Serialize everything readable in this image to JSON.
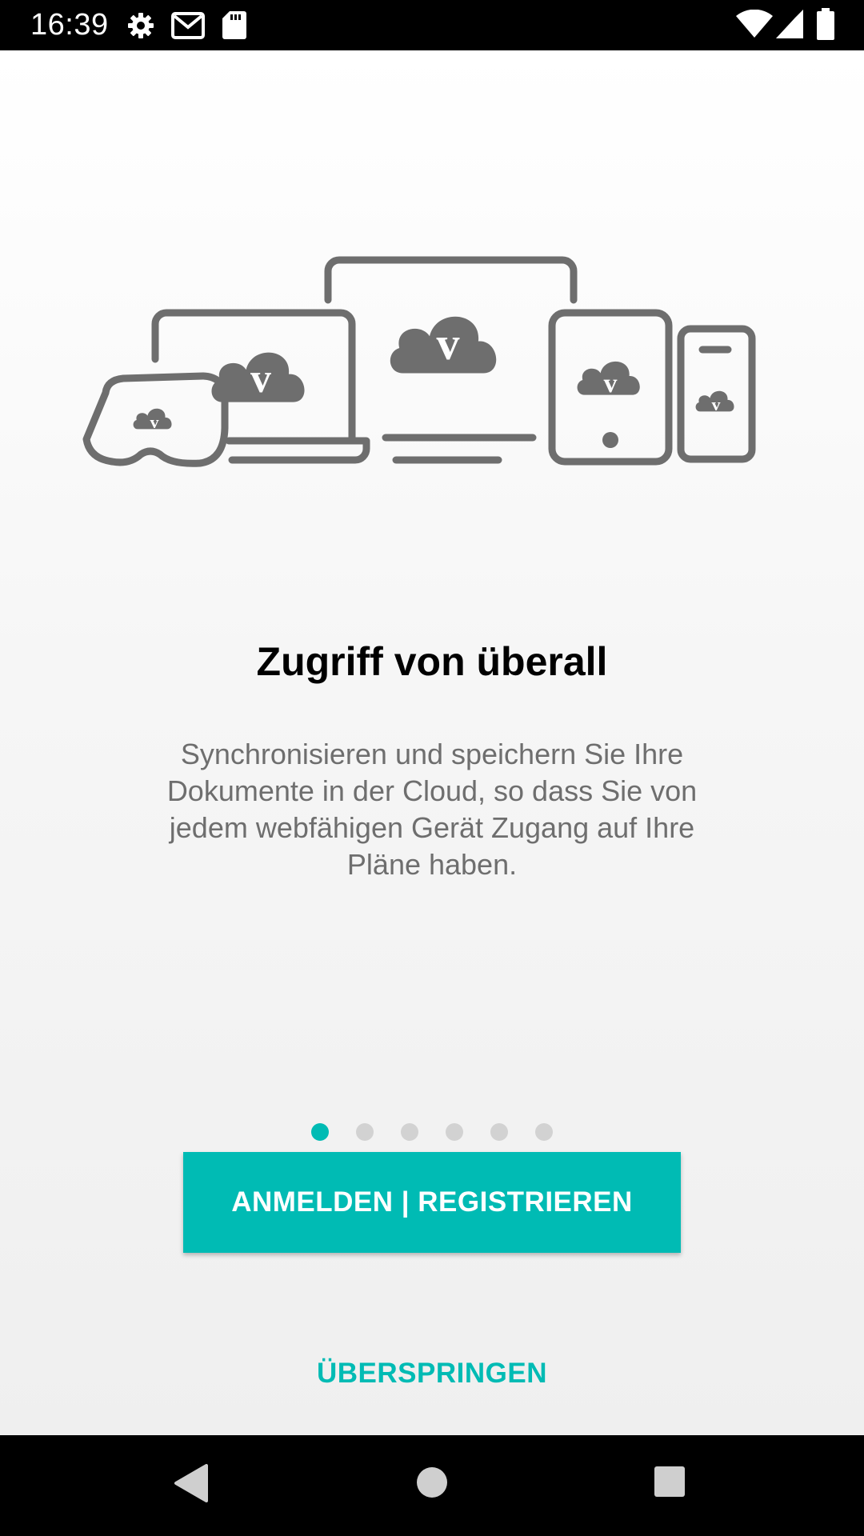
{
  "status_bar": {
    "time": "16:39",
    "icons": [
      "gear-icon",
      "gmail-icon",
      "sd-card-icon",
      "wifi-icon",
      "signal-icon",
      "battery-icon"
    ]
  },
  "onboarding": {
    "title": "Zugriff von überall",
    "description": "Synchronisieren und speichern Sie Ihre Dokumente in der Cloud, so dass Sie von jedem webfähigen Gerät Zugang auf Ihre Pläne haben.",
    "illustration_icons": [
      "vr-headset-icon",
      "laptop-icon",
      "monitor-icon",
      "tablet-icon",
      "phone-icon",
      "cloud-icon"
    ],
    "pager": {
      "total": 6,
      "active_index": 0
    },
    "primary_button_label": "ANMELDEN | REGISTRIEREN",
    "secondary_button_label": "ÜBERSPRINGEN"
  },
  "nav_bar": {
    "icons": [
      "back-icon",
      "home-icon",
      "recents-icon"
    ]
  },
  "colors": {
    "accent": "#00bbb4",
    "illustration_gray": "#6e6e6e",
    "text_gray": "#6e6e6e"
  }
}
